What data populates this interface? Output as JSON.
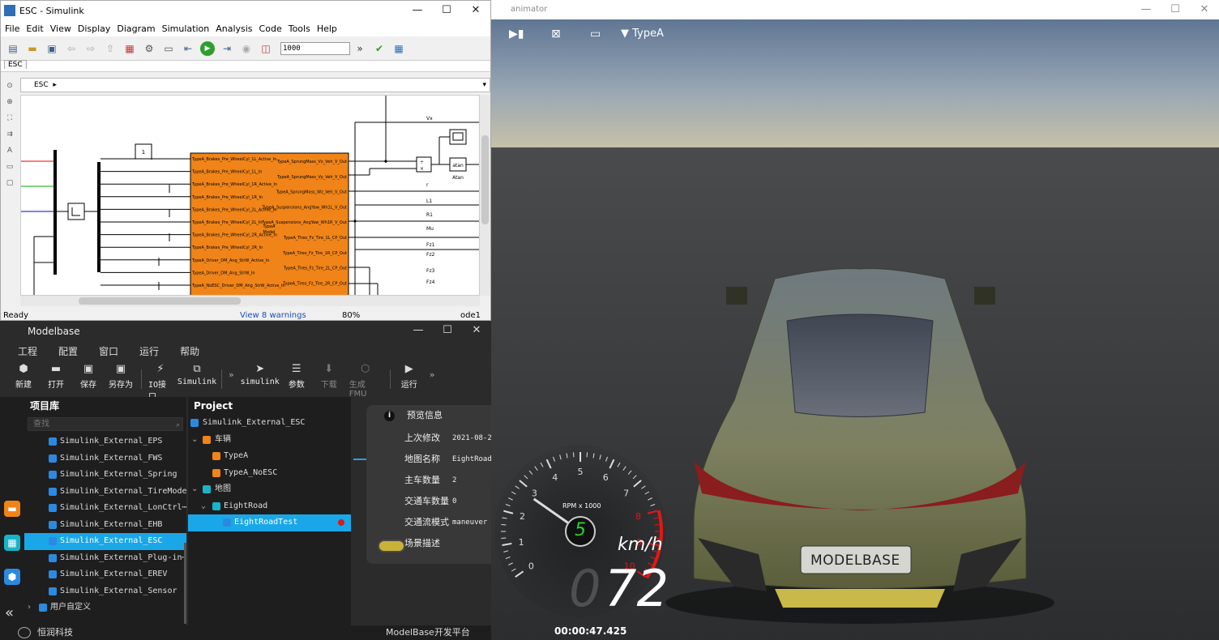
{
  "simulink": {
    "window_title": "ESC - Simulink",
    "window_controls": [
      "—",
      "☐",
      "✕"
    ],
    "menu": [
      "File",
      "Edit",
      "View",
      "Display",
      "Diagram",
      "Simulation",
      "Analysis",
      "Code",
      "Tools",
      "Help"
    ],
    "stop_time": "1000",
    "tab": "ESC",
    "breadcrumb": "ESC",
    "canvas": {
      "constant_value": "1",
      "block_inputs": [
        "TypeA_Brakes_Pre_WheelCyl_1L_Active_In",
        "TypeA_Brakes_Pre_WheelCyl_1L_In",
        "TypeA_Brakes_Pre_WheelCyl_1R_Active_In",
        "TypeA_Brakes_Pre_WheelCyl_1R_In",
        "TypeA_Brakes_Pre_WheelCyl_2L_Active_In",
        "TypeA_Brakes_Pre_WheelCyl_2L_In",
        "TypeA_Brakes_Pre_WheelCyl_2R_Active_In",
        "TypeA_Brakes_Pre_WheelCyl_2R_In",
        "TypeA_Driver_DM_Ang_StrW_Active_In",
        "TypeA_Driver_DM_Ang_StrW_In",
        "TypeA_NoESC_Driver_DM_Ang_StrW_Active_In"
      ],
      "block_outputs": [
        "TypeA_SprungMass_Vx_Veh_V_Out",
        "TypeA_SprungMass_Vy_Veh_V_Out",
        "TypeA_SprungMass_Wz_Veh_V_Out",
        "TypeA_Suspensions_AngYaw_Wh1L_V_Out",
        "TypeA_Suspensions_AngYaw_Wh1R_V_Out",
        "TypeA_Tires_Fz_Tire_1L_CP_Out",
        "TypeA_Tires_Fz_Tire_1R_CP_Out",
        "TypeA_Tires_Fz_Tire_2L_CP_Out",
        "TypeA_Tires_Fz_Tire_2R_CP_Out"
      ],
      "block_center_label": "TypeA\nModel",
      "signal_labels": [
        "Vx",
        "r",
        "L1",
        "R1",
        "Mu",
        "Fz1",
        "Fz2",
        "Fz3",
        "Fz4"
      ],
      "atan_block": "atan",
      "atan_caption": "Atan",
      "product_signs": [
        "÷",
        "×"
      ]
    },
    "status": {
      "state": "Ready",
      "warnings": "View 8 warnings",
      "zoom": "80%",
      "solver": "ode1"
    }
  },
  "modelbase": {
    "window_title": "Modelbase",
    "window_controls": [
      "—",
      "☐",
      "✕"
    ],
    "menu": [
      "工程",
      "配置",
      "窗口",
      "运行",
      "帮助"
    ],
    "tools": [
      {
        "label": "新建",
        "icon": "cube-icon",
        "glyph": "⬢",
        "dim": false
      },
      {
        "label": "打开",
        "icon": "folder-open-icon",
        "glyph": "▬",
        "dim": false
      },
      {
        "label": "保存",
        "icon": "save-icon",
        "glyph": "▣",
        "dim": false
      },
      {
        "label": "另存为",
        "icon": "save-as-icon",
        "glyph": "▣",
        "dim": false
      },
      {
        "label": "IO接口",
        "icon": "plug-icon",
        "glyph": "⚡",
        "dim": false
      },
      {
        "label": "Simulink",
        "icon": "hierarchy-icon",
        "glyph": "⧉",
        "dim": false
      },
      {
        "label": "simulink",
        "icon": "cursor-icon",
        "glyph": "➤",
        "dim": false
      },
      {
        "label": "参数",
        "icon": "sliders-icon",
        "glyph": "☰",
        "dim": false
      },
      {
        "label": "下载",
        "icon": "download-icon",
        "glyph": "⬇",
        "dim": true
      },
      {
        "label": "生成FMU",
        "icon": "package-icon",
        "glyph": "⬡",
        "dim": true
      },
      {
        "label": "运行",
        "icon": "play-circle-icon",
        "glyph": "▶",
        "dim": false
      }
    ],
    "library": {
      "title": "项目库",
      "search_placeholder": "查找",
      "items": [
        "Simulink_External_EPS",
        "Simulink_External_FWS",
        "Simulink_External_Spring",
        "Simulink_External_TireModel",
        "Simulink_External_LonCtrl⋯",
        "Simulink_External_EHB",
        "Simulink_External_ESC",
        "Simulink_External_Plug-in⋯",
        "Simulink_External_EREV",
        "Simulink_External_Sensor"
      ],
      "selected_index": 6,
      "user_group": "用户自定义"
    },
    "project": {
      "title": "Project",
      "root": "Simulink_External_ESC",
      "vehicle_group": "车辆",
      "vehicles": [
        "TypeA",
        "TypeA_NoESC"
      ],
      "map_group": "地图",
      "map": "EightRoad",
      "scenario": "EightRoadTest"
    },
    "preview": {
      "title": "预览信息",
      "rows": [
        {
          "k": "上次修改",
          "v": "2021-08-2"
        },
        {
          "k": "地图名称",
          "v": "EightRoad"
        },
        {
          "k": "主车数量",
          "v": "2"
        },
        {
          "k": "交通车数量",
          "v": "0"
        },
        {
          "k": "交通流模式",
          "v": "maneuver"
        },
        {
          "k": "场景描述",
          "v": ""
        }
      ]
    },
    "footer": {
      "company": "恒润科技",
      "platform": "ModelBase开发平台"
    }
  },
  "animator": {
    "window_title": "animator",
    "window_controls": [
      "—",
      "☐",
      "✕"
    ],
    "vehicle_selector": "TypeA",
    "gauge": {
      "rpm_caption": "RPM x 1000",
      "gear": "5",
      "ticks": [
        "0",
        "1",
        "2",
        "3",
        "4",
        "5",
        "6",
        "7",
        "8",
        "9",
        "10"
      ],
      "speed_unit": "km/h",
      "speed_ghost": "0",
      "speed": "72",
      "rpm_value": 2.8
    },
    "elapsed": "00:00:47.425",
    "license_plate": "MODELBASE"
  }
}
